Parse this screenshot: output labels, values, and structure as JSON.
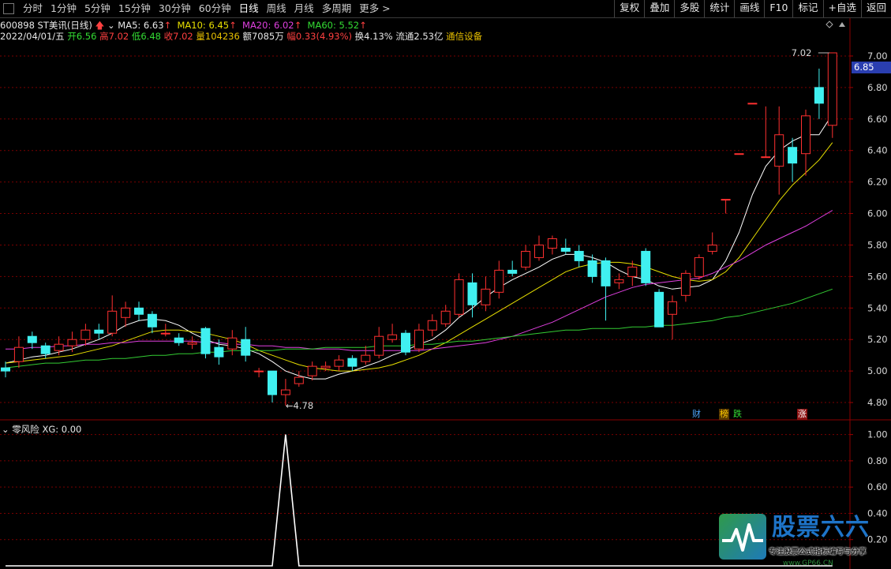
{
  "toolbar": {
    "tabs": [
      "分时",
      "1分钟",
      "5分钟",
      "15分钟",
      "30分钟",
      "60分钟",
      "日线",
      "周线",
      "月线",
      "多周期",
      "更多 >"
    ],
    "active_tab": "日线",
    "right_buttons": [
      "复权",
      "叠加",
      "多股",
      "统计",
      "画线",
      "F10",
      "标记",
      "+自选",
      "返回"
    ]
  },
  "info": {
    "code_name": "600898 ST美讯(日线)",
    "ma5": "MA5: 6.63",
    "ma10": "MA10: 6.45",
    "ma20": "MA20: 6.02",
    "ma60": "MA60: 5.52",
    "up_arrow": "↑"
  },
  "ohlc": {
    "date": "2022/04/01/五",
    "open": "开6.56",
    "high": "高7.02",
    "low": "低6.48",
    "close": "收7.02",
    "volume": "量104236",
    "amount": "额7085万",
    "change": "幅0.33(4.93%)",
    "turnover": "换4.13%",
    "float_cap": "流通2.53亿",
    "industry": "通信设备"
  },
  "colors": {
    "up": "#ff3030",
    "down": "#40f0f0",
    "ma5": "#ffffff",
    "ma10": "#e8e000",
    "ma20": "#e040e0",
    "ma60": "#33cc33",
    "grid": "#7a0000",
    "tag_bg": "#2a3eb0"
  },
  "chart_data": [
    {
      "type": "candlestick",
      "title": "600898 ST美讯(日线)",
      "ylim": [
        4.7,
        7.08
      ],
      "y_ticks": [
        "7.00",
        "6.80",
        "6.60",
        "6.40",
        "6.20",
        "6.00",
        "5.80",
        "5.60",
        "5.40",
        "5.20",
        "5.00",
        "4.80"
      ],
      "last_price": "6.85",
      "annotations": {
        "high_label": "7.02",
        "low_label": "←4.78"
      },
      "badges": [
        "财",
        "榜",
        "跌",
        "涨"
      ],
      "candles": [
        {
          "o": 5.02,
          "c": 5.0,
          "h": 5.06,
          "l": 4.96
        },
        {
          "o": 5.06,
          "c": 5.15,
          "h": 5.22,
          "l": 5.02
        },
        {
          "o": 5.22,
          "c": 5.18,
          "h": 5.25,
          "l": 5.14
        },
        {
          "o": 5.16,
          "c": 5.11,
          "h": 5.18,
          "l": 5.08
        },
        {
          "o": 5.13,
          "c": 5.17,
          "h": 5.22,
          "l": 5.1
        },
        {
          "o": 5.16,
          "c": 5.2,
          "h": 5.25,
          "l": 5.12
        },
        {
          "o": 5.2,
          "c": 5.26,
          "h": 5.3,
          "l": 5.16
        },
        {
          "o": 5.26,
          "c": 5.24,
          "h": 5.3,
          "l": 5.2
        },
        {
          "o": 5.24,
          "c": 5.38,
          "h": 5.48,
          "l": 5.22
        },
        {
          "o": 5.34,
          "c": 5.4,
          "h": 5.44,
          "l": 5.28
        },
        {
          "o": 5.4,
          "c": 5.36,
          "h": 5.44,
          "l": 5.32
        },
        {
          "o": 5.36,
          "c": 5.28,
          "h": 5.38,
          "l": 5.24
        },
        {
          "o": 5.24,
          "c": 5.24,
          "h": 5.3,
          "l": 5.22
        },
        {
          "o": 5.21,
          "c": 5.18,
          "h": 5.24,
          "l": 5.16
        },
        {
          "o": 5.17,
          "c": 5.18,
          "h": 5.22,
          "l": 5.14
        },
        {
          "o": 5.27,
          "c": 5.11,
          "h": 5.28,
          "l": 5.08
        },
        {
          "o": 5.15,
          "c": 5.09,
          "h": 5.2,
          "l": 5.04
        },
        {
          "o": 5.14,
          "c": 5.21,
          "h": 5.26,
          "l": 5.1
        },
        {
          "o": 5.2,
          "c": 5.1,
          "h": 5.28,
          "l": 5.06
        },
        {
          "o": 5.0,
          "c": 5.0,
          "h": 5.02,
          "l": 4.96
        },
        {
          "o": 5.0,
          "c": 4.85,
          "h": 5.0,
          "l": 4.8
        },
        {
          "o": 4.85,
          "c": 4.88,
          "h": 4.95,
          "l": 4.78
        },
        {
          "o": 4.92,
          "c": 4.96,
          "h": 5.0,
          "l": 4.9
        },
        {
          "o": 4.97,
          "c": 5.03,
          "h": 5.06,
          "l": 4.94
        },
        {
          "o": 5.02,
          "c": 5.03,
          "h": 5.06,
          "l": 5.0
        },
        {
          "o": 5.03,
          "c": 5.07,
          "h": 5.1,
          "l": 5.0
        },
        {
          "o": 5.08,
          "c": 5.03,
          "h": 5.1,
          "l": 5.0
        },
        {
          "o": 5.06,
          "c": 5.1,
          "h": 5.16,
          "l": 5.04
        },
        {
          "o": 5.1,
          "c": 5.22,
          "h": 5.28,
          "l": 5.08
        },
        {
          "o": 5.2,
          "c": 5.23,
          "h": 5.3,
          "l": 5.18
        },
        {
          "o": 5.24,
          "c": 5.12,
          "h": 5.26,
          "l": 5.1
        },
        {
          "o": 5.14,
          "c": 5.26,
          "h": 5.3,
          "l": 5.12
        },
        {
          "o": 5.26,
          "c": 5.32,
          "h": 5.36,
          "l": 5.22
        },
        {
          "o": 5.3,
          "c": 5.38,
          "h": 5.42,
          "l": 5.28
        },
        {
          "o": 5.36,
          "c": 5.58,
          "h": 5.62,
          "l": 5.34
        },
        {
          "o": 5.56,
          "c": 5.42,
          "h": 5.62,
          "l": 5.34
        },
        {
          "o": 5.42,
          "c": 5.52,
          "h": 5.6,
          "l": 5.38
        },
        {
          "o": 5.5,
          "c": 5.64,
          "h": 5.7,
          "l": 5.46
        },
        {
          "o": 5.64,
          "c": 5.62,
          "h": 5.7,
          "l": 5.6
        },
        {
          "o": 5.66,
          "c": 5.76,
          "h": 5.8,
          "l": 5.64
        },
        {
          "o": 5.72,
          "c": 5.8,
          "h": 5.86,
          "l": 5.7
        },
        {
          "o": 5.78,
          "c": 5.84,
          "h": 5.86,
          "l": 5.74
        },
        {
          "o": 5.78,
          "c": 5.76,
          "h": 5.84,
          "l": 5.74
        },
        {
          "o": 5.76,
          "c": 5.7,
          "h": 5.8,
          "l": 5.66
        },
        {
          "o": 5.7,
          "c": 5.6,
          "h": 5.74,
          "l": 5.56
        },
        {
          "o": 5.7,
          "c": 5.54,
          "h": 5.72,
          "l": 5.32
        },
        {
          "o": 5.56,
          "c": 5.58,
          "h": 5.62,
          "l": 5.52
        },
        {
          "o": 5.6,
          "c": 5.66,
          "h": 5.7,
          "l": 5.54
        },
        {
          "o": 5.76,
          "c": 5.56,
          "h": 5.78,
          "l": 5.54
        },
        {
          "o": 5.5,
          "c": 5.28,
          "h": 5.52,
          "l": 5.28
        },
        {
          "o": 5.36,
          "c": 5.44,
          "h": 5.48,
          "l": 5.2
        },
        {
          "o": 5.48,
          "c": 5.62,
          "h": 5.64,
          "l": 5.44
        },
        {
          "o": 5.6,
          "c": 5.72,
          "h": 5.74,
          "l": 5.58
        },
        {
          "o": 5.76,
          "c": 5.8,
          "h": 5.88,
          "l": 5.74
        },
        {
          "o": 6.09,
          "c": 6.09,
          "h": 6.09,
          "l": 6.0
        },
        {
          "o": 6.38,
          "c": 6.38,
          "h": 6.38,
          "l": 6.38
        },
        {
          "o": 6.7,
          "c": 6.7,
          "h": 6.7,
          "l": 6.7
        },
        {
          "o": 6.36,
          "c": 6.36,
          "h": 6.68,
          "l": 6.36
        },
        {
          "o": 6.3,
          "c": 6.5,
          "h": 6.68,
          "l": 6.12
        },
        {
          "o": 6.42,
          "c": 6.32,
          "h": 6.48,
          "l": 6.2
        },
        {
          "o": 6.38,
          "c": 6.62,
          "h": 6.66,
          "l": 6.24
        },
        {
          "o": 6.8,
          "c": 6.7,
          "h": 6.92,
          "l": 6.6
        },
        {
          "o": 6.56,
          "c": 7.02,
          "h": 7.02,
          "l": 6.48
        }
      ],
      "series": [
        {
          "name": "MA5",
          "values": [
            5.05,
            5.07,
            5.09,
            5.1,
            5.12,
            5.14,
            5.17,
            5.2,
            5.24,
            5.29,
            5.32,
            5.33,
            5.32,
            5.29,
            5.24,
            5.2,
            5.17,
            5.16,
            5.14,
            5.11,
            5.06,
            5.0,
            4.97,
            4.95,
            4.95,
            4.98,
            5.0,
            5.03,
            5.06,
            5.1,
            5.13,
            5.17,
            5.2,
            5.26,
            5.34,
            5.4,
            5.47,
            5.53,
            5.58,
            5.62,
            5.66,
            5.71,
            5.74,
            5.74,
            5.72,
            5.69,
            5.64,
            5.6,
            5.58,
            5.54,
            5.52,
            5.53,
            5.54,
            5.58,
            5.7,
            5.88,
            6.12,
            6.3,
            6.4,
            6.46,
            6.5,
            6.5,
            6.63
          ]
        },
        {
          "name": "MA10",
          "values": [
            5.05,
            5.06,
            5.07,
            5.08,
            5.09,
            5.1,
            5.12,
            5.14,
            5.16,
            5.19,
            5.22,
            5.25,
            5.26,
            5.26,
            5.25,
            5.24,
            5.22,
            5.2,
            5.17,
            5.13,
            5.1,
            5.07,
            5.04,
            5.02,
            5.01,
            5.0,
            5.0,
            5.01,
            5.02,
            5.04,
            5.07,
            5.1,
            5.14,
            5.18,
            5.23,
            5.28,
            5.33,
            5.38,
            5.43,
            5.48,
            5.53,
            5.58,
            5.63,
            5.66,
            5.68,
            5.69,
            5.69,
            5.68,
            5.66,
            5.63,
            5.6,
            5.58,
            5.57,
            5.58,
            5.63,
            5.72,
            5.84,
            5.96,
            6.08,
            6.18,
            6.26,
            6.34,
            6.45
          ]
        },
        {
          "name": "MA20",
          "values": [
            5.14,
            5.14,
            5.15,
            5.15,
            5.16,
            5.16,
            5.17,
            5.17,
            5.18,
            5.18,
            5.19,
            5.19,
            5.19,
            5.19,
            5.19,
            5.18,
            5.18,
            5.17,
            5.17,
            5.16,
            5.16,
            5.15,
            5.15,
            5.14,
            5.14,
            5.14,
            5.13,
            5.13,
            5.13,
            5.13,
            5.13,
            5.13,
            5.14,
            5.15,
            5.16,
            5.17,
            5.18,
            5.2,
            5.22,
            5.25,
            5.28,
            5.31,
            5.35,
            5.39,
            5.43,
            5.47,
            5.5,
            5.53,
            5.55,
            5.56,
            5.57,
            5.58,
            5.59,
            5.62,
            5.66,
            5.7,
            5.75,
            5.8,
            5.84,
            5.88,
            5.92,
            5.97,
            6.02
          ]
        },
        {
          "name": "MA60",
          "values": [
            5.02,
            5.03,
            5.04,
            5.05,
            5.05,
            5.06,
            5.07,
            5.07,
            5.08,
            5.08,
            5.09,
            5.1,
            5.1,
            5.11,
            5.11,
            5.12,
            5.12,
            5.13,
            5.13,
            5.13,
            5.13,
            5.14,
            5.14,
            5.14,
            5.15,
            5.15,
            5.15,
            5.15,
            5.16,
            5.16,
            5.16,
            5.17,
            5.17,
            5.18,
            5.19,
            5.19,
            5.2,
            5.21,
            5.22,
            5.23,
            5.24,
            5.25,
            5.26,
            5.26,
            5.27,
            5.27,
            5.27,
            5.28,
            5.28,
            5.29,
            5.29,
            5.3,
            5.31,
            5.32,
            5.34,
            5.35,
            5.37,
            5.39,
            5.41,
            5.43,
            5.46,
            5.49,
            5.52
          ]
        }
      ]
    },
    {
      "type": "line",
      "title": "零风险 XG: 0.00",
      "ylim": [
        0,
        1.1
      ],
      "y_ticks": [
        "1.00",
        "0.80",
        "0.60",
        "0.40",
        "0.20"
      ],
      "series": [
        {
          "name": "XG",
          "values": [
            0,
            0,
            0,
            0,
            0,
            0,
            0,
            0,
            0,
            0,
            0,
            0,
            0,
            0,
            0,
            0,
            0,
            0,
            0,
            0,
            0,
            1,
            0,
            0,
            0,
            0,
            0,
            0,
            0,
            0,
            0,
            0,
            0,
            0,
            0,
            0,
            0,
            0,
            0,
            0,
            0,
            0,
            0,
            0,
            0,
            0,
            0,
            0,
            0,
            0,
            0,
            0,
            0,
            0,
            0,
            0,
            0,
            0,
            0,
            0,
            0,
            0,
            0
          ]
        }
      ]
    }
  ],
  "watermark": {
    "title": "股票六六",
    "subtitle": "专注股票公式指标编写与分享",
    "url": "www.GP66.CN"
  }
}
